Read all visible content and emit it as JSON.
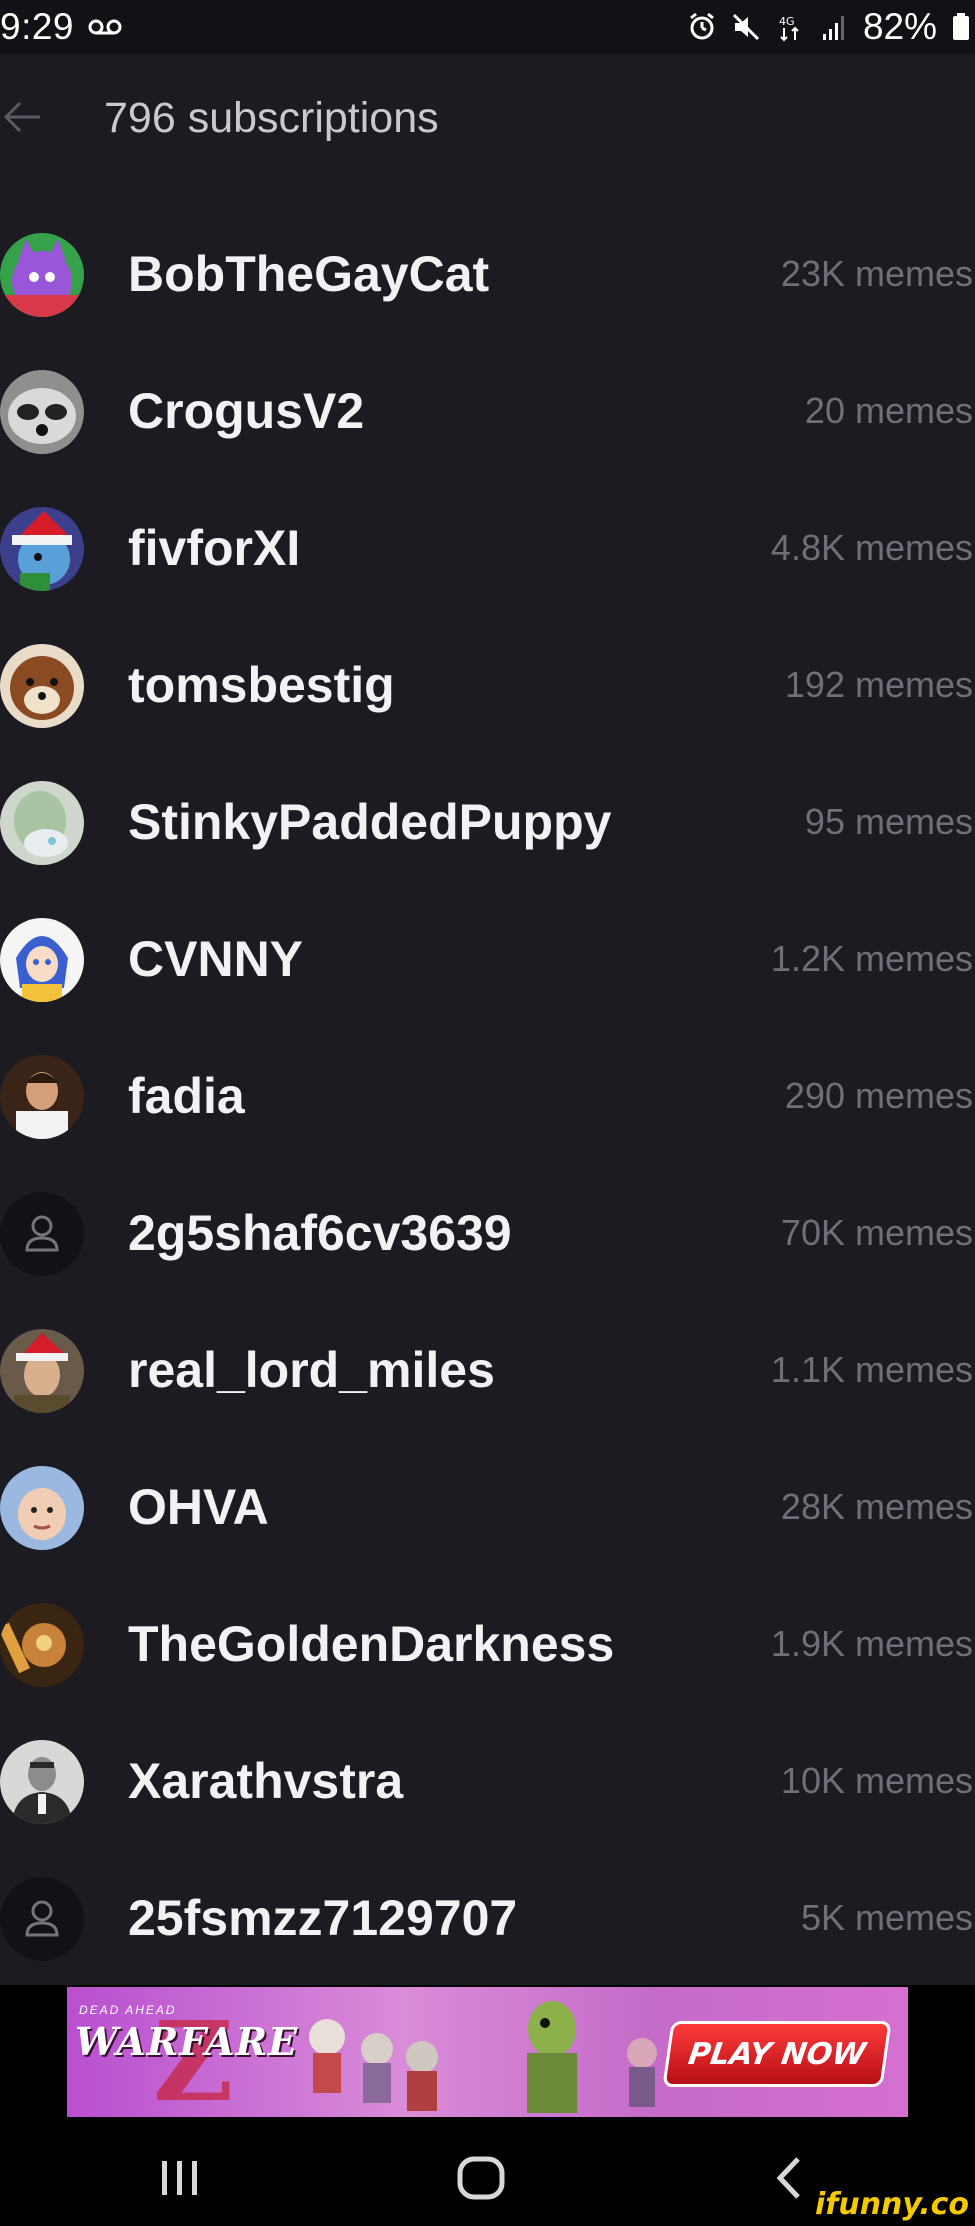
{
  "status_bar": {
    "time": "9:29",
    "battery": "82%",
    "icons": [
      "voicemail-icon",
      "alarm-icon",
      "mute-icon",
      "data-icon",
      "signal-icon",
      "battery-icon"
    ]
  },
  "header": {
    "title": "796 subscriptions",
    "back_icon": "back-arrow-icon"
  },
  "subscriptions": [
    {
      "name": "BobTheGayCat",
      "count": "23K memes"
    },
    {
      "name": "CrogusV2",
      "count": "20 memes"
    },
    {
      "name": "fivforXI",
      "count": "4.8K memes"
    },
    {
      "name": "tomsbestig",
      "count": "192 memes"
    },
    {
      "name": "StinkyPaddedPuppy",
      "count": "95 memes"
    },
    {
      "name": "CVNNY",
      "count": "1.2K memes"
    },
    {
      "name": "fadia",
      "count": "290 memes"
    },
    {
      "name": "2g5shaf6cv3639",
      "count": "70K memes"
    },
    {
      "name": "real_lord_miles",
      "count": "1.1K memes"
    },
    {
      "name": "OHVA",
      "count": "28K memes"
    },
    {
      "name": "TheGoldenDarkness",
      "count": "1.9K memes"
    },
    {
      "name": "Xarathvstra",
      "count": "10K memes"
    },
    {
      "name": "25fsmzz7129707",
      "count": "5K memes"
    }
  ],
  "ad": {
    "logo_small": "DEAD AHEAD",
    "logo": "WARFARE",
    "cta": "PLAY NOW"
  },
  "nav": {
    "icons": [
      "recent-apps-icon",
      "home-icon",
      "back-icon"
    ]
  },
  "watermark": "ifunny.co",
  "colors": {
    "background": "#1b1b21",
    "status_bar": "#121216",
    "name": "#f2f2f4",
    "count": "#6f6f78",
    "ad_button": "#e0202a"
  }
}
